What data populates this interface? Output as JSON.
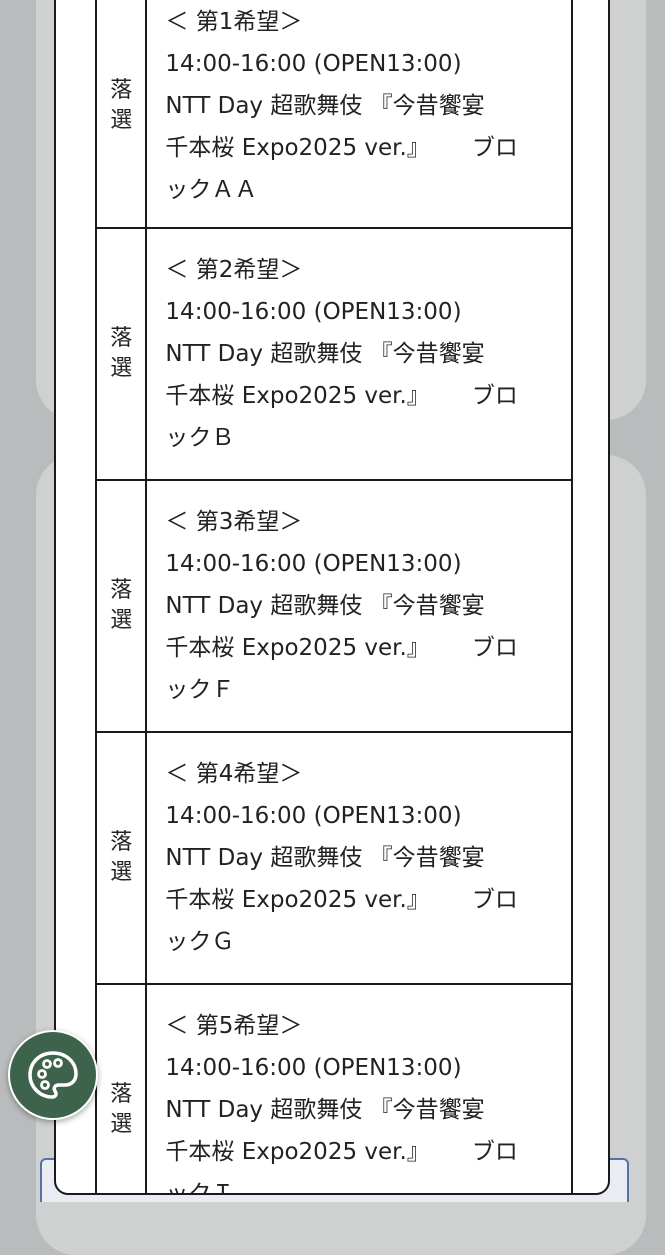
{
  "results": [
    {
      "status": "落選",
      "choice": "＜ 第1希望＞",
      "time": "14:00-16:00 (OPEN13:00)",
      "event_line1": "NTT Day 超歌舞伎 『今昔饗宴",
      "event_line2a": "千本桜 Expo2025 ver.』",
      "event_line2b": "ブロ",
      "event_line3": "ックＡＡ"
    },
    {
      "status": "落選",
      "choice": "＜ 第2希望＞",
      "time": "14:00-16:00 (OPEN13:00)",
      "event_line1": "NTT Day 超歌舞伎 『今昔饗宴",
      "event_line2a": "千本桜 Expo2025 ver.』",
      "event_line2b": "ブロ",
      "event_line3": "ックＢ"
    },
    {
      "status": "落選",
      "choice": "＜ 第3希望＞",
      "time": "14:00-16:00 (OPEN13:00)",
      "event_line1": "NTT Day 超歌舞伎 『今昔饗宴",
      "event_line2a": "千本桜 Expo2025 ver.』",
      "event_line2b": "ブロ",
      "event_line3": "ックＦ"
    },
    {
      "status": "落選",
      "choice": "＜ 第4希望＞",
      "time": "14:00-16:00 (OPEN13:00)",
      "event_line1": "NTT Day 超歌舞伎 『今昔饗宴",
      "event_line2a": "千本桜 Expo2025 ver.』",
      "event_line2b": "ブロ",
      "event_line3": "ックＧ"
    },
    {
      "status": "落選",
      "choice": "＜ 第5希望＞",
      "time": "14:00-16:00 (OPEN13:00)",
      "event_line1": "NTT Day 超歌舞伎 『今昔饗宴",
      "event_line2a": "千本桜 Expo2025 ver.』",
      "event_line2b": "ブロ",
      "event_line3": "ックＩ"
    }
  ],
  "fab": {
    "icon": "palette-icon",
    "color": "#3e634c"
  }
}
